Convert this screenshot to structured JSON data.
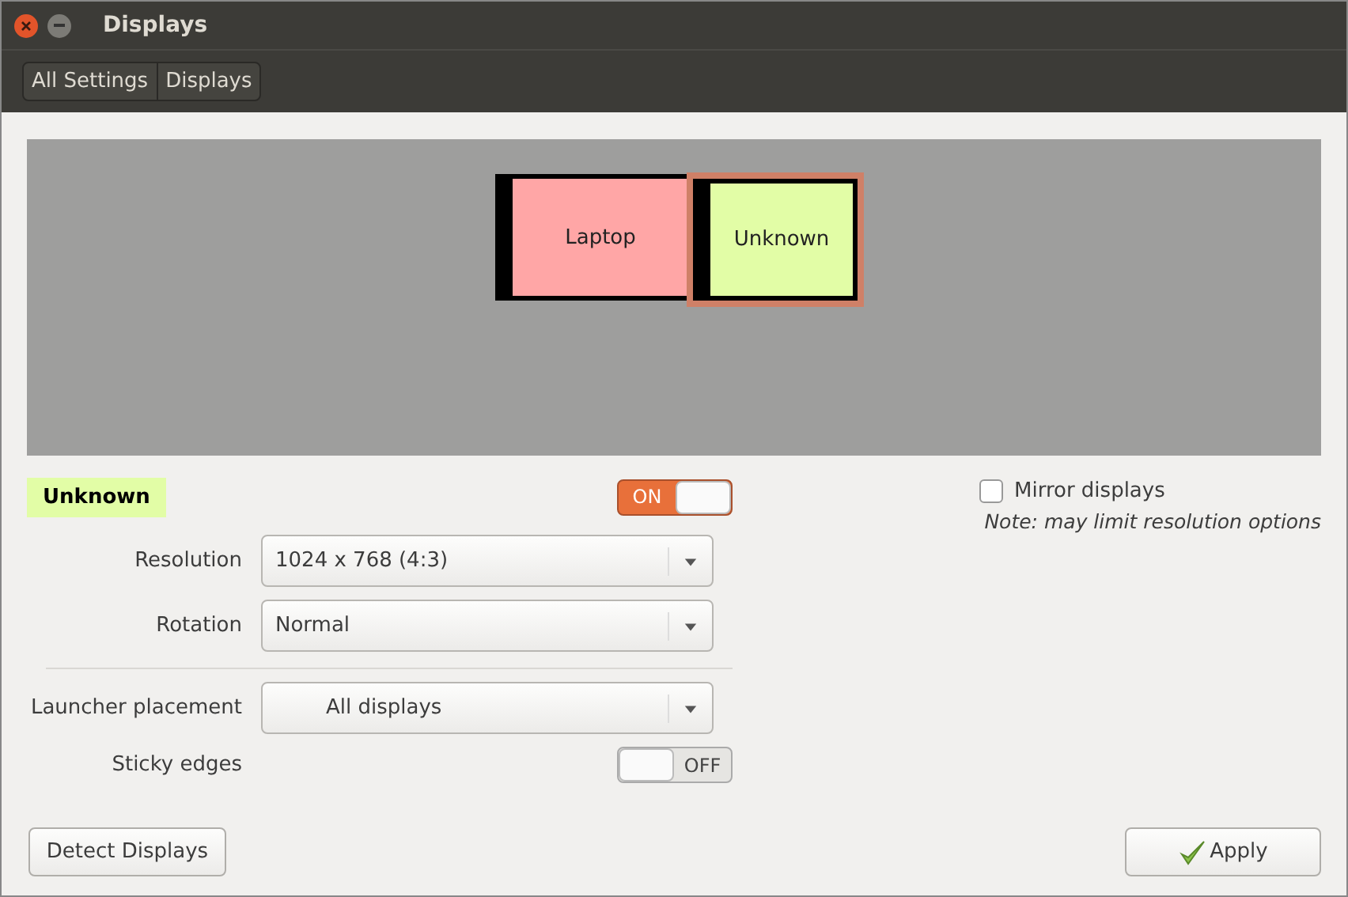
{
  "window": {
    "title": "Displays"
  },
  "breadcrumbs": [
    {
      "label": "All Settings"
    },
    {
      "label": "Displays"
    }
  ],
  "arrangement": {
    "displays": [
      {
        "label": "Laptop",
        "color": "#ffa6a6",
        "selected": false
      },
      {
        "label": "Unknown",
        "color": "#e2fda6",
        "selected": true
      }
    ]
  },
  "details": {
    "display_name": {
      "label": "Unknown",
      "color": "#e2fda6"
    },
    "power_switch": {
      "label": "ON",
      "on": true
    },
    "fields": [
      {
        "kind": "dropdown",
        "label": "Resolution",
        "value": "1024 x 768 (4:3)",
        "centered": false
      },
      {
        "kind": "dropdown",
        "label": "Rotation",
        "value": "Normal",
        "centered": false
      },
      {
        "kind": "divider"
      },
      {
        "kind": "dropdown",
        "label": "Launcher placement",
        "value": "All displays",
        "centered": true
      },
      {
        "kind": "switch",
        "label": "Sticky edges",
        "switch": {
          "label": "OFF",
          "on": false
        }
      }
    ]
  },
  "mirror": {
    "label": "Mirror displays",
    "checked": false,
    "note": "Note: may limit resolution options"
  },
  "buttons": [
    {
      "kind": "plain",
      "label": "Detect Displays"
    },
    {
      "kind": "apply",
      "label": "Apply"
    }
  ]
}
